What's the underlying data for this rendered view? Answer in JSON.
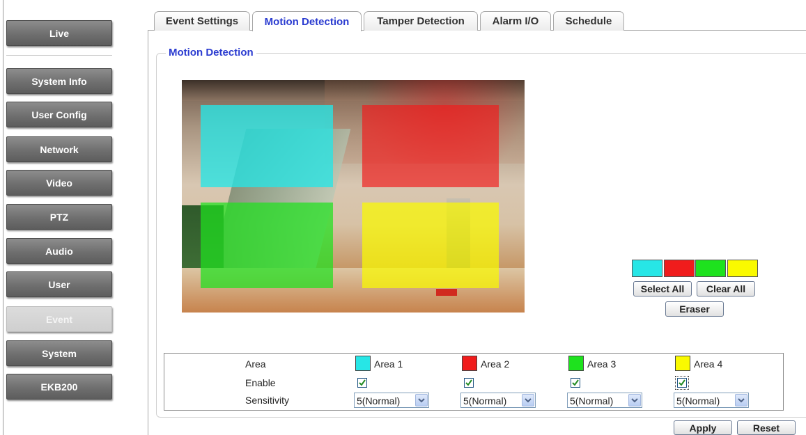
{
  "nav": {
    "live": "Live",
    "items": [
      "System Info",
      "User Config",
      "Network",
      "Video",
      "PTZ",
      "Audio",
      "User",
      "Event",
      "System",
      "EKB200"
    ]
  },
  "tabs": [
    "Event Settings",
    "Motion Detection",
    "Tamper Detection",
    "Alarm I/O",
    "Schedule"
  ],
  "section_title": "Motion Detection",
  "zone_colors": [
    "#27e6e6",
    "#f01c1c",
    "#1ee21e",
    "#fafa00"
  ],
  "palette": {
    "select_all": "Select All",
    "clear_all": "Clear All",
    "eraser": "Eraser"
  },
  "table": {
    "row_area": "Area",
    "row_enable": "Enable",
    "row_sensitivity": "Sensitivity",
    "areas": [
      {
        "name": "Area 1",
        "enabled": true,
        "sensitivity": "5(Normal)"
      },
      {
        "name": "Area 2",
        "enabled": true,
        "sensitivity": "5(Normal)"
      },
      {
        "name": "Area 3",
        "enabled": true,
        "sensitivity": "5(Normal)"
      },
      {
        "name": "Area 4",
        "enabled": true,
        "sensitivity": "5(Normal)"
      }
    ]
  },
  "actions": {
    "apply": "Apply",
    "reset": "Reset"
  },
  "icons": {
    "checkbox": "checkmark-icon",
    "dropdown": "chevron-down-icon"
  }
}
